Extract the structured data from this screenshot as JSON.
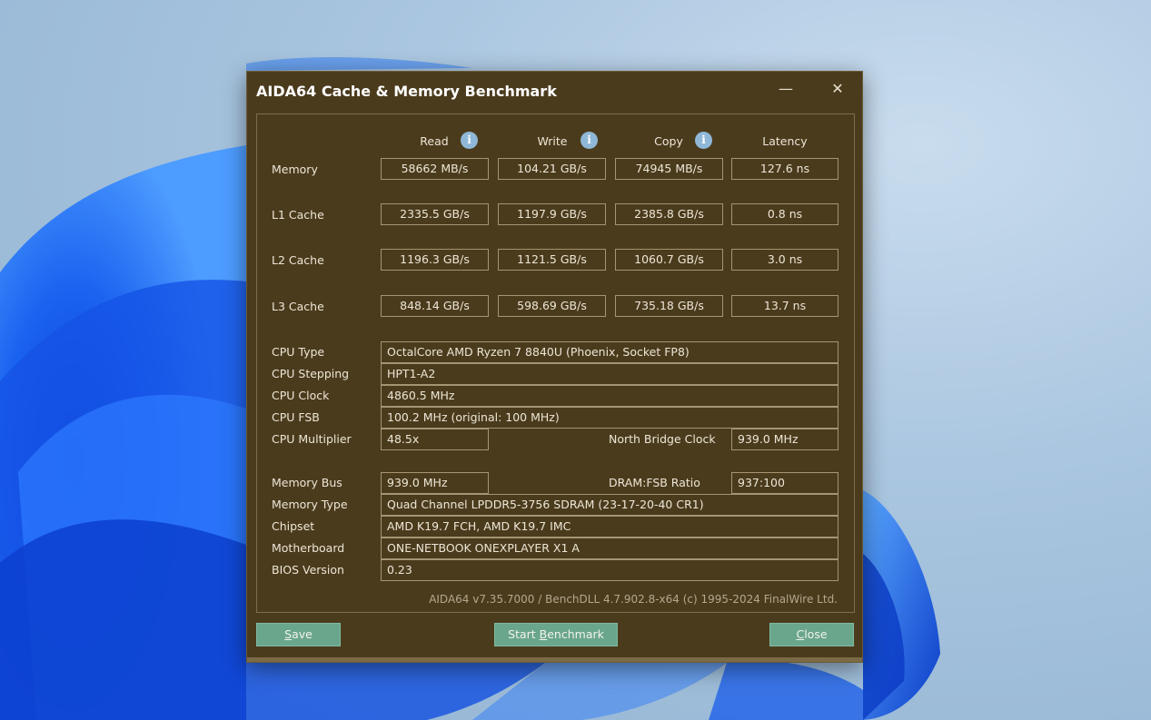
{
  "window": {
    "title": "AIDA64 Cache & Memory Benchmark",
    "minimize_glyph": "—",
    "close_glyph": "✕"
  },
  "columns": {
    "read": "Read",
    "write": "Write",
    "copy": "Copy",
    "latency": "Latency",
    "info_glyph": "i"
  },
  "bench_rows": [
    {
      "label": "Memory",
      "read": "58662 MB/s",
      "write": "104.21 GB/s",
      "copy": "74945 MB/s",
      "latency": "127.6 ns"
    },
    {
      "label": "L1 Cache",
      "read": "2335.5 GB/s",
      "write": "1197.9 GB/s",
      "copy": "2385.8 GB/s",
      "latency": "0.8 ns"
    },
    {
      "label": "L2 Cache",
      "read": "1196.3 GB/s",
      "write": "1121.5 GB/s",
      "copy": "1060.7 GB/s",
      "latency": "3.0 ns"
    },
    {
      "label": "L3 Cache",
      "read": "848.14 GB/s",
      "write": "598.69 GB/s",
      "copy": "735.18 GB/s",
      "latency": "13.7 ns"
    }
  ],
  "cpu": {
    "type_label": "CPU Type",
    "type_value": "OctalCore AMD Ryzen 7 8840U  (Phoenix, Socket FP8)",
    "stepping_label": "CPU Stepping",
    "stepping_value": "HPT1-A2",
    "clock_label": "CPU Clock",
    "clock_value": "4860.5 MHz",
    "fsb_label": "CPU FSB",
    "fsb_value": "100.2 MHz  (original: 100 MHz)",
    "multiplier_label": "CPU Multiplier",
    "multiplier_value": "48.5x",
    "nb_clock_label": "North Bridge Clock",
    "nb_clock_value": "939.0 MHz"
  },
  "memory": {
    "bus_label": "Memory Bus",
    "bus_value": "939.0 MHz",
    "ratio_label": "DRAM:FSB Ratio",
    "ratio_value": "937:100",
    "type_label": "Memory Type",
    "type_value": "Quad Channel LPDDR5-3756 SDRAM  (23-17-20-40 CR1)",
    "chipset_label": "Chipset",
    "chipset_value": "AMD K19.7 FCH, AMD K19.7 IMC",
    "motherboard_label": "Motherboard",
    "motherboard_value": "ONE-NETBOOK ONEXPLAYER X1 A",
    "bios_label": "BIOS Version",
    "bios_value": "0.23"
  },
  "footer": "AIDA64 v7.35.7000 / BenchDLL 4.7.902.8-x64  (c) 1995-2024 FinalWire Ltd.",
  "buttons": {
    "save_u": "S",
    "save_rest": "ave",
    "start_pre": "Start ",
    "start_u": "B",
    "start_rest": "enchmark",
    "close_u": "C",
    "close_rest": "lose"
  }
}
